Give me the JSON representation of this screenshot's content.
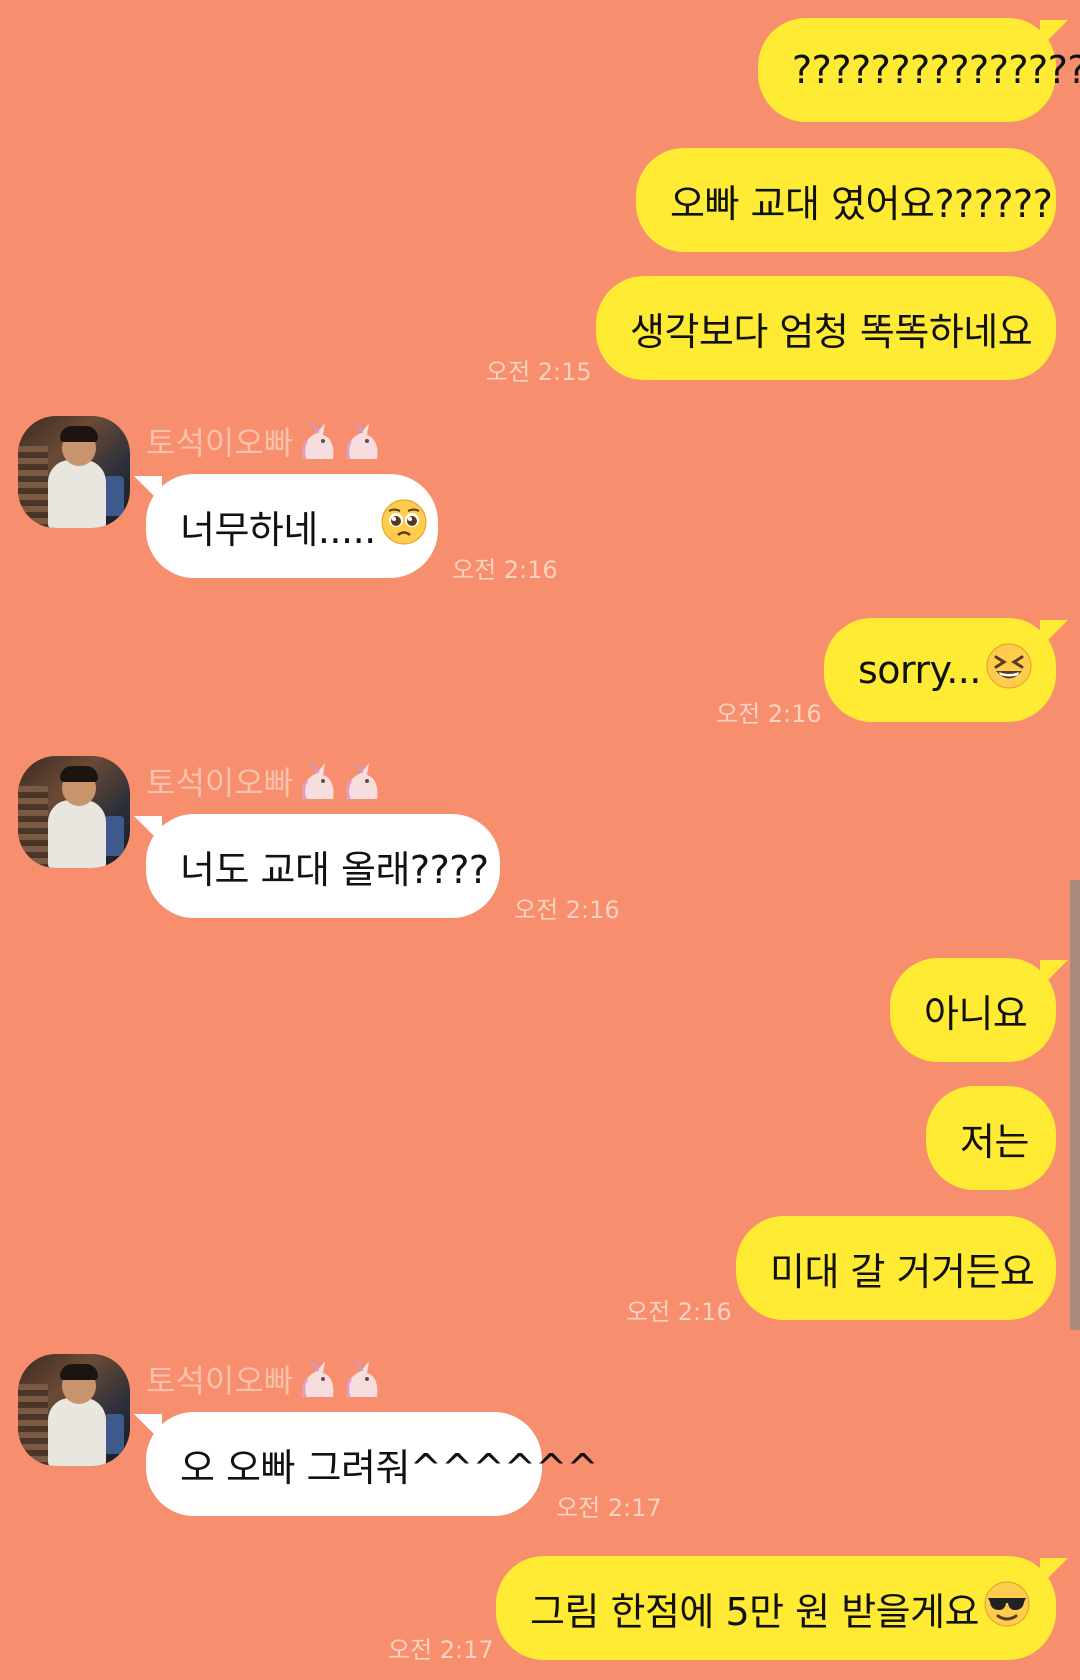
{
  "contact": {
    "name": "토석이오빠",
    "name_icons": [
      "unicorn-icon",
      "unicorn-icon"
    ]
  },
  "messages": [
    {
      "from": "me",
      "text": "???????????????",
      "time": ""
    },
    {
      "from": "me",
      "text": "오빠 교대 였어요??????",
      "time": ""
    },
    {
      "from": "me",
      "text": "생각보다 엄청 똑똑하네요",
      "time": "오전 2:15"
    },
    {
      "from": "them",
      "sender": "토석이오빠",
      "text": "너무하네.....",
      "emoji": "pleading-face-icon",
      "time": "오전 2:16"
    },
    {
      "from": "me",
      "text": "sorry...",
      "emoji": "laughing-squint-face-icon",
      "time": "오전 2:16"
    },
    {
      "from": "them",
      "sender": "토석이오빠",
      "text": "너도 교대 올래????",
      "time": "오전 2:16"
    },
    {
      "from": "me",
      "text": "아니요",
      "time": ""
    },
    {
      "from": "me",
      "text": "저는",
      "time": ""
    },
    {
      "from": "me",
      "text": "미대 갈 거거든요",
      "time": "오전 2:16"
    },
    {
      "from": "them",
      "sender": "토석이오빠",
      "text": "오 오빠 그려줘^^^^^^",
      "time": "오전 2:17"
    },
    {
      "from": "me",
      "text": "그림 한점에 5만 원 받을게요",
      "emoji": "sunglasses-face-icon",
      "time": "오전 2:17"
    }
  ],
  "colors": {
    "background": "#F78E6E",
    "my_bubble": "#FFEB33",
    "their_bubble": "#FFFFFF",
    "timestamp": "#FCD2C0",
    "sender_name": "#FCC1AC"
  }
}
